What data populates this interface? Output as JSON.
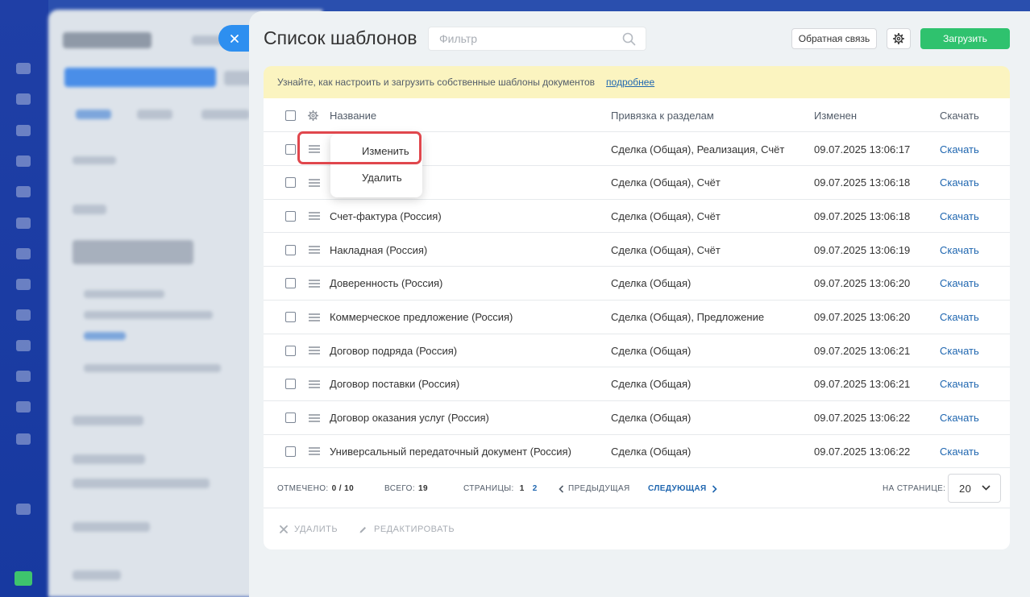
{
  "panel": {
    "title": "Список шаблонов",
    "filter_placeholder": "Фильтр",
    "feedback_label": "Обратная связь",
    "upload_label": "Загрузить",
    "close_icon": "close-icon"
  },
  "notice": {
    "text": "Узнайте, как настроить и загрузить собственные шаблоны документов",
    "link": "подробнее"
  },
  "table": {
    "columns": [
      "Название",
      "Привязка к разделам",
      "Изменен",
      "Скачать"
    ],
    "rows": [
      {
        "name": "",
        "sections": "Сделка (Общая), Реализация, Счёт",
        "modified": "09.07.2025 13:06:17",
        "download": "Скачать"
      },
      {
        "name": "",
        "sections": "Сделка (Общая), Счёт",
        "modified": "09.07.2025 13:06:18",
        "download": "Скачать"
      },
      {
        "name": "Счет-фактура (Россия)",
        "sections": "Сделка (Общая), Счёт",
        "modified": "09.07.2025 13:06:18",
        "download": "Скачать"
      },
      {
        "name": "Накладная (Россия)",
        "sections": "Сделка (Общая), Счёт",
        "modified": "09.07.2025 13:06:19",
        "download": "Скачать"
      },
      {
        "name": "Доверенность (Россия)",
        "sections": "Сделка (Общая)",
        "modified": "09.07.2025 13:06:20",
        "download": "Скачать"
      },
      {
        "name": "Коммерческое предложение (Россия)",
        "sections": "Сделка (Общая), Предложение",
        "modified": "09.07.2025 13:06:20",
        "download": "Скачать"
      },
      {
        "name": "Договор подряда (Россия)",
        "sections": "Сделка (Общая)",
        "modified": "09.07.2025 13:06:21",
        "download": "Скачать"
      },
      {
        "name": "Договор поставки (Россия)",
        "sections": "Сделка (Общая)",
        "modified": "09.07.2025 13:06:21",
        "download": "Скачать"
      },
      {
        "name": "Договор оказания услуг (Россия)",
        "sections": "Сделка (Общая)",
        "modified": "09.07.2025 13:06:22",
        "download": "Скачать"
      },
      {
        "name": "Универсальный передаточный документ (Россия)",
        "sections": "Сделка (Общая)",
        "modified": "09.07.2025 13:06:22",
        "download": "Скачать"
      }
    ]
  },
  "context_menu": {
    "edit": "Изменить",
    "delete": "Удалить"
  },
  "footer": {
    "selected_label": "ОТМЕЧЕНО:",
    "selected_value": "0 / 10",
    "total_label": "ВСЕГО:",
    "total_value": "19",
    "pages_label": "СТРАНИЦЫ:",
    "page_1": "1",
    "page_2": "2",
    "prev": "ПРЕДЫДУЩАЯ",
    "next": "СЛЕДУЮЩАЯ",
    "per_page_label": "НА СТРАНИЦЕ:",
    "per_page_value": "20"
  },
  "actions": {
    "delete": "УДАЛИТЬ",
    "edit": "РЕДАКТИРОВАТЬ"
  },
  "colors": {
    "accent_green": "#2fc26e",
    "link_blue": "#2067b0",
    "highlight_red": "#e0474d",
    "notice_bg": "#fbf4c0"
  }
}
